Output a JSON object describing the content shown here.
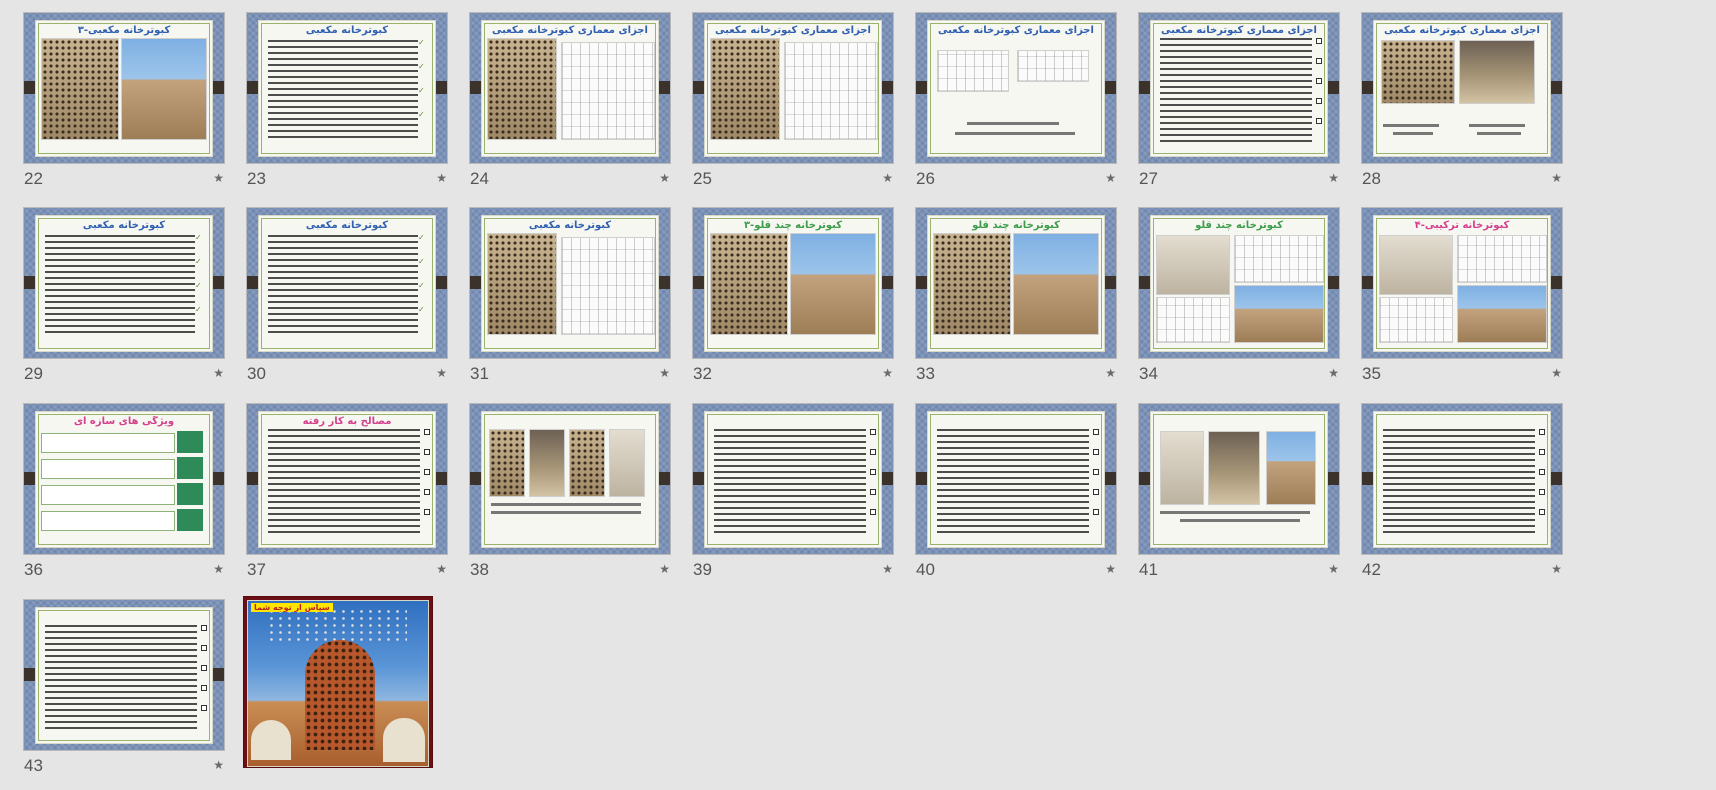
{
  "slides": [
    {
      "number": "22",
      "title": "۳-کبوترخانه مکعبی",
      "layout": "two-photos"
    },
    {
      "number": "23",
      "title": "کبوترخانه مکعبی",
      "layout": "text-checks"
    },
    {
      "number": "24",
      "title": "اجزای معماری کبوترخانه مکعبی",
      "layout": "photo-drawing"
    },
    {
      "number": "25",
      "title": "اجزای معماری کبوترخانه مکعبی",
      "layout": "photo-drawing"
    },
    {
      "number": "26",
      "title": "اجزای معماری کبوترخانه مکعبی",
      "layout": "plans"
    },
    {
      "number": "27",
      "title": "اجزای معماری کبوترخانه مکعبی",
      "layout": "text-bullets"
    },
    {
      "number": "28",
      "title": "اجزای معماری کبوترخانه مکعبی",
      "layout": "two-photos-caption"
    },
    {
      "number": "29",
      "title": "کبوترخانه مکعبی",
      "layout": "text-checks"
    },
    {
      "number": "30",
      "title": "کبوترخانه مکعبی",
      "layout": "text-checks"
    },
    {
      "number": "31",
      "title": "کبوترخانه مکعبی",
      "layout": "photo-drawing"
    },
    {
      "number": "32",
      "title": "۳-کبوترخانه چند قلو",
      "title_color": "green",
      "layout": "two-photos"
    },
    {
      "number": "33",
      "title": "کبوترخانه چند قلو",
      "title_color": "green",
      "layout": "two-photos"
    },
    {
      "number": "34",
      "title": "کبوترخانه چند قلو",
      "title_color": "green",
      "layout": "photo-collage"
    },
    {
      "number": "35",
      "title": "۴-کبوترخانه ترکیبی",
      "title_color": "pink",
      "layout": "photo-collage"
    },
    {
      "number": "36",
      "title": "ویژگی های سازه ای",
      "title_color": "pink",
      "layout": "chevrons"
    },
    {
      "number": "37",
      "title": "مصالح به کار رفته",
      "title_color": "pink",
      "layout": "text-bullets"
    },
    {
      "number": "38",
      "title": "",
      "layout": "four-photos"
    },
    {
      "number": "39",
      "title": "",
      "layout": "text-bullets"
    },
    {
      "number": "40",
      "title": "",
      "layout": "text-bullets"
    },
    {
      "number": "41",
      "title": "",
      "layout": "three-photos"
    },
    {
      "number": "42",
      "title": "",
      "layout": "text-bullets"
    },
    {
      "number": "43",
      "title": "",
      "layout": "text-bullets"
    },
    {
      "number": "",
      "title": "",
      "special_tag": "سپاس از توجه شما",
      "layout": "final-photo"
    }
  ],
  "star_glyph": "★",
  "colors": {
    "background": "#e5e5e5",
    "slide_frame": "#7a91b8",
    "title_blue": "#2e5fb0",
    "title_green": "#3d9c4a",
    "title_pink": "#d4408d",
    "selected_border": "#6b0f14"
  }
}
